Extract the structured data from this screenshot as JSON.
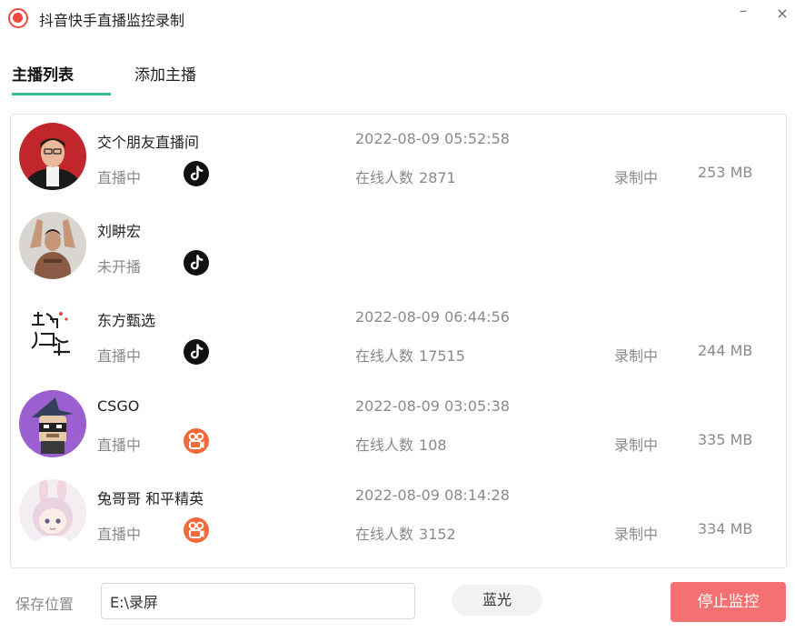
{
  "window": {
    "title": "抖音快手直播监控录制",
    "minimize_glyph": "–",
    "close_glyph": "×"
  },
  "tabs": [
    {
      "label": "主播列表",
      "active": true
    },
    {
      "label": "添加主播",
      "active": false
    }
  ],
  "streamers": [
    {
      "name": "交个朋友直播间",
      "status": "直播中",
      "platform": "douyin",
      "time": "2022-08-09 05:52:58",
      "viewers_label": "在线人数",
      "viewers": "2871",
      "recording": "录制中",
      "size": "253 MB"
    },
    {
      "name": "刘畊宏",
      "status": "未开播",
      "platform": "douyin",
      "time": "",
      "viewers_label": "",
      "viewers": "",
      "recording": "",
      "size": ""
    },
    {
      "name": "东方甄选",
      "status": "直播中",
      "platform": "douyin",
      "time": "2022-08-09 06:44:56",
      "viewers_label": "在线人数",
      "viewers": "17515",
      "recording": "录制中",
      "size": "244 MB"
    },
    {
      "name": "CSGO",
      "status": "直播中",
      "platform": "kuaishou",
      "time": "2022-08-09 03:05:38",
      "viewers_label": "在线人数",
      "viewers": "108",
      "recording": "录制中",
      "size": "335 MB"
    },
    {
      "name": "兔哥哥 和平精英",
      "status": "直播中",
      "platform": "kuaishou",
      "time": "2022-08-09 08:14:28",
      "viewers_label": "在线人数",
      "viewers": "3152",
      "recording": "录制中",
      "size": "334 MB"
    }
  ],
  "footer": {
    "save_label": "保存位置",
    "save_path": "E:\\录屏",
    "quality_label": "蓝光",
    "stop_label": "停止监控"
  },
  "colors": {
    "accent_green": "#35c089",
    "stop_button": "#f47171",
    "app_icon": "#f0493f",
    "kuaishou": "#f26b3a",
    "douyin": "#111111"
  },
  "icons": {
    "app": "record-icon",
    "douyin": "douyin-icon",
    "kuaishou": "kuaishou-icon"
  }
}
